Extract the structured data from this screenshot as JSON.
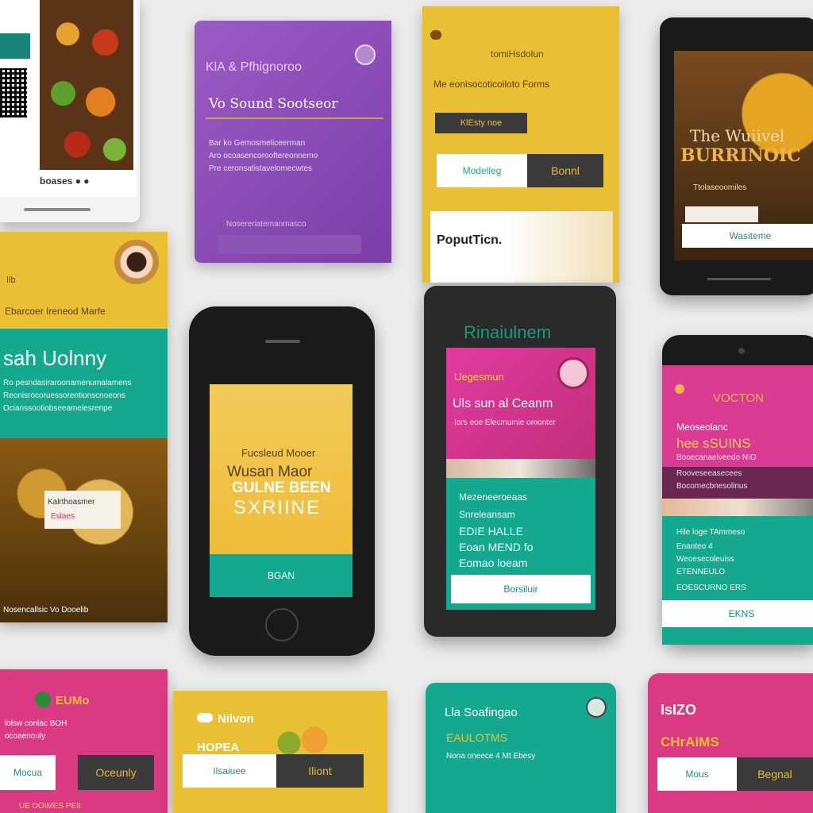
{
  "colors": {
    "purple": "#8d4ab2",
    "yellow": "#e9bf34",
    "teal": "#14a88e",
    "magenta": "#d23a85",
    "dark": "#1a1a1a"
  },
  "c1": {
    "caption": "boases ● ●"
  },
  "c2": {
    "title": "KlA & Pfhignoroo",
    "subtitle": "Vo Sound Sootseor",
    "body": [
      "Bar ko Gemosmeliceerman",
      "Aro ocoasencorooftereonnemo",
      "Pre ceronsatistavelomecwtes"
    ],
    "footer": "Nosereriatemanmasco"
  },
  "c3": {
    "header": "tomiHsdolun",
    "sub": "Me eonisocoticoiloto Forms",
    "tag": "KlEsty noe",
    "btn_light": "Modelleg",
    "btn_dark": "Bonnl",
    "banner": "PoputTicn."
  },
  "c4": {
    "headline1": "The Wuiivel",
    "headline2": "BURRINOIC",
    "body": "Ttolaseoomiles",
    "btn": "Wasiteme"
  },
  "c5": {
    "tag": "Ilb",
    "sub": "Ebarcoer Ireneod Marfe",
    "title": "sah Uolnny",
    "body": [
      "Ro pesndasiraroonamenumalamens",
      "Reonisrocoruessorentionscnoeons",
      "Ocianssootiobseeamelesrenpe"
    ],
    "badge": "Kalrthoasmer",
    "badge2": "Eslaes",
    "footer": "Nosencallsic Vo Dooelib"
  },
  "p1": {
    "line1": "Fucsleud Mooer",
    "line2": "Wusan Maor",
    "line3": "GULNE BEEN",
    "line4": "SXRIINE",
    "btn": "BGAN"
  },
  "p2": {
    "logo": "Rinaiulnem",
    "sub": "Uegesmun",
    "title": "Uls sun al Ceanm",
    "body": "Iors eoe Elecmumie omonter",
    "list": [
      "Mezeneeroeaas",
      "Snreleansam",
      "EDIE HALLE",
      "Eoan MEND fo",
      "Eomao loeam"
    ],
    "btn": "Borsiluir"
  },
  "p3": {
    "title": "VOCTON",
    "sub": "Meoseolanc",
    "headline": "hee sSUINS",
    "body": [
      "Booecanaeiveedo NIO",
      "Rooveseeasecees",
      "Bocomecbnesolinus"
    ],
    "list": [
      "Hile loge TAmmeso",
      "Enanteo 4",
      "Weoesecoleuiss",
      "ETENNEULO",
      "EOESCURNO ERS"
    ],
    "btn": "EKNS"
  },
  "c6": {
    "logo": "EUMo",
    "body": "lolsw conlac BOH",
    "sub": "ocoaenouly",
    "btn_light": "Mocua",
    "btn_dark": "Oceunly",
    "footer": "UE DOIMES PEII"
  },
  "c7": {
    "logo": "Nilvon",
    "tag": "HOPEA",
    "btn_light": "Ilsaiuee",
    "btn_dark": "Iliont"
  },
  "c8": {
    "logo": "Lla Soafingao",
    "tag": "EAULOTMS",
    "sub": "Nona oneece 4 Mt Ebesy"
  },
  "c9": {
    "logo": "IsIZO",
    "tag": "CHrAIMS",
    "btn_light": "Mous",
    "btn_dark": "Begnal"
  }
}
